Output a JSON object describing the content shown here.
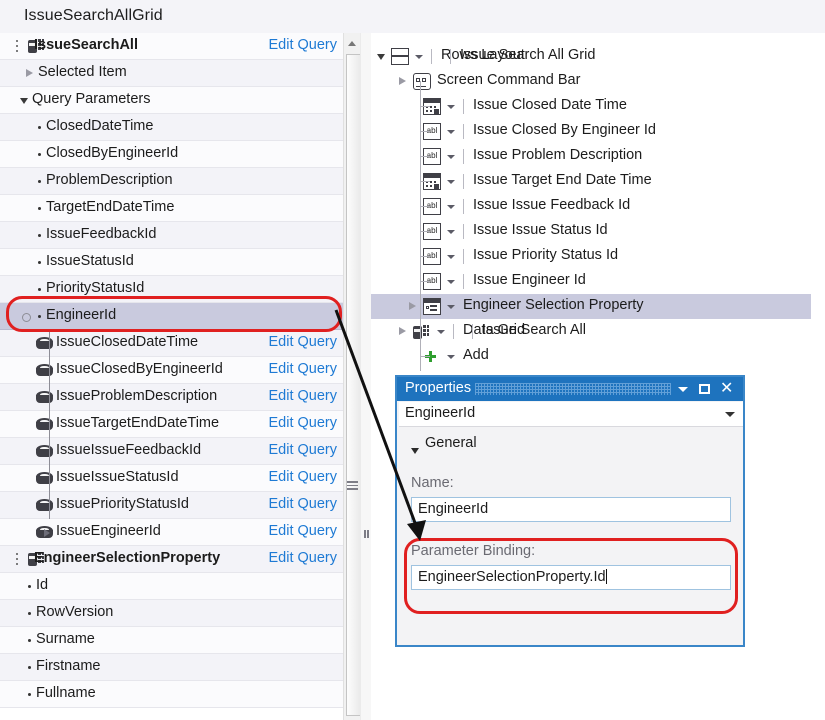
{
  "header": {
    "title": "IssueSearchAllGrid"
  },
  "left_panel": {
    "rows": [
      {
        "label": "IssueSearchAll",
        "kind": "query-root",
        "bold": true,
        "action": "Edit Query",
        "indent": 34,
        "handle": true
      },
      {
        "label": "Selected Item",
        "kind": "expander-collapsed",
        "indent": 38
      },
      {
        "label": "Query Parameters",
        "kind": "expander-expanded",
        "indent": 32
      },
      {
        "label": "ClosedDateTime",
        "kind": "bullet",
        "indent": 46
      },
      {
        "label": "ClosedByEngineerId",
        "kind": "bullet",
        "indent": 46
      },
      {
        "label": "ProblemDescription",
        "kind": "bullet",
        "indent": 46
      },
      {
        "label": "TargetEndDateTime",
        "kind": "bullet",
        "indent": 46
      },
      {
        "label": "IssueFeedbackId",
        "kind": "bullet",
        "indent": 46
      },
      {
        "label": "IssueStatusId",
        "kind": "bullet",
        "indent": 46
      },
      {
        "label": "PriorityStatusId",
        "kind": "bullet",
        "indent": 46
      },
      {
        "label": "EngineerId",
        "kind": "bullet",
        "indent": 46,
        "selected": true
      },
      {
        "label": "IssueClosedDateTime",
        "kind": "entity",
        "indent": 56,
        "action": "Edit Query"
      },
      {
        "label": "IssueClosedByEngineerId",
        "kind": "entity",
        "indent": 56,
        "action": "Edit Query"
      },
      {
        "label": "IssueProblemDescription",
        "kind": "entity",
        "indent": 56,
        "action": "Edit Query"
      },
      {
        "label": "IssueTargetEndDateTime",
        "kind": "entity",
        "indent": 56,
        "action": "Edit Query"
      },
      {
        "label": "IssueIssueFeedbackId",
        "kind": "entity",
        "indent": 56,
        "action": "Edit Query"
      },
      {
        "label": "IssueIssueStatusId",
        "kind": "entity",
        "indent": 56,
        "action": "Edit Query"
      },
      {
        "label": "IssuePriorityStatusId",
        "kind": "entity",
        "indent": 56,
        "action": "Edit Query"
      },
      {
        "label": "IssueEngineerId",
        "kind": "entity-arrow",
        "indent": 56,
        "action": "Edit Query"
      },
      {
        "label": "EngineerSelectionProperty",
        "kind": "query-root",
        "bold": true,
        "action": "Edit Query",
        "indent": 34,
        "handle": true
      },
      {
        "label": "Id",
        "kind": "bullet",
        "indent": 36
      },
      {
        "label": "RowVersion",
        "kind": "bullet",
        "indent": 36
      },
      {
        "label": "Surname",
        "kind": "bullet",
        "indent": 36
      },
      {
        "label": "Firstname",
        "kind": "bullet",
        "indent": 36
      },
      {
        "label": "Fullname",
        "kind": "bullet",
        "indent": 36
      }
    ]
  },
  "right_tree": {
    "rows": [
      {
        "label": "Rows Layout",
        "sublabel": "Issue Search All Grid",
        "icon": "rows-layout-icon",
        "indent": 30,
        "expander": "expanded",
        "dropdown": true,
        "separator": true
      },
      {
        "label": "Screen Command Bar",
        "sublabel": "",
        "icon": "command-bar-icon",
        "indent": 52,
        "expander": "collapsed",
        "dropdown": false,
        "separator": false
      },
      {
        "label": "Issue Closed Date Time",
        "sublabel": "",
        "icon": "date-picker-icon",
        "indent": 62,
        "dropdown": true,
        "separator": true
      },
      {
        "label": "Issue Closed By Engineer Id",
        "sublabel": "",
        "icon": "textbox-icon",
        "indent": 62,
        "dropdown": true,
        "separator": true
      },
      {
        "label": "Issue Problem Description",
        "sublabel": "",
        "icon": "textbox-icon",
        "indent": 62,
        "dropdown": true,
        "separator": true
      },
      {
        "label": "Issue Target End Date Time",
        "sublabel": "",
        "icon": "date-picker-icon",
        "indent": 62,
        "dropdown": true,
        "separator": true
      },
      {
        "label": "Issue Issue Feedback Id",
        "sublabel": "",
        "icon": "textbox-icon",
        "indent": 62,
        "dropdown": true,
        "separator": true
      },
      {
        "label": "Issue Issue Status Id",
        "sublabel": "",
        "icon": "textbox-icon",
        "indent": 62,
        "dropdown": true,
        "separator": true
      },
      {
        "label": "Issue Priority Status Id",
        "sublabel": "",
        "icon": "textbox-icon",
        "indent": 62,
        "dropdown": true,
        "separator": true
      },
      {
        "label": "Issue Engineer Id",
        "sublabel": "",
        "icon": "textbox-icon",
        "indent": 62,
        "dropdown": true,
        "separator": true
      },
      {
        "label": "Engineer Selection Property",
        "sublabel": "",
        "icon": "group-property-icon",
        "indent": 62,
        "expander": "collapsed",
        "dropdown": true,
        "separator": false,
        "selected": true
      },
      {
        "label": "Data Grid",
        "sublabel": "Issue Search All",
        "icon": "data-grid-icon",
        "indent": 52,
        "expander": "collapsed",
        "dropdown": true,
        "separator": true
      },
      {
        "label": "Add",
        "sublabel": "",
        "icon": "plus-icon",
        "indent": 62,
        "dropdown": true,
        "separator": false
      }
    ]
  },
  "properties_panel": {
    "title": "Properties",
    "window_buttons": [
      "dropdown-icon",
      "maximize-icon",
      "close-icon"
    ],
    "target_combo_value": "EngineerId",
    "group_header": "General",
    "fields": [
      {
        "label": "Name:",
        "value": "EngineerId",
        "highlighted": false
      },
      {
        "label": "Parameter Binding:",
        "value": "EngineerSelectionProperty.Id",
        "highlighted": true,
        "caret": true
      }
    ]
  },
  "annotations": {
    "ellipse_color": "#e02020",
    "arrow_color": "#111111",
    "highlight_row": "EngineerId",
    "highlight_field": "Parameter Binding:"
  }
}
